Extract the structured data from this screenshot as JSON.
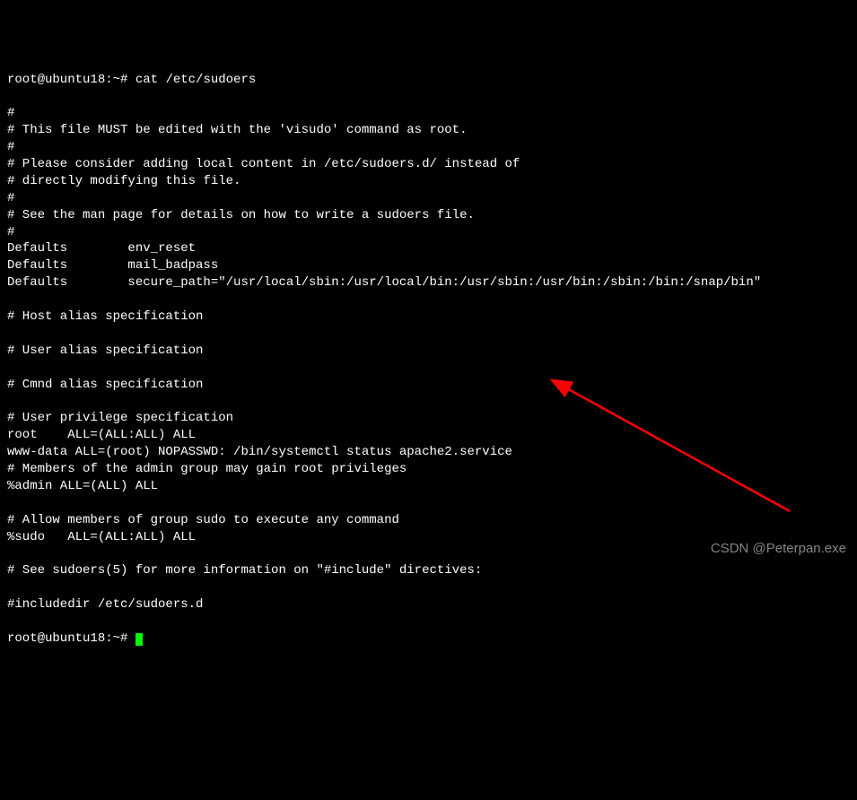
{
  "prompt1": {
    "user": "root@ubuntu18",
    "sep": ":",
    "path": "~",
    "symbol": "#",
    "command": "cat /etc/sudoers"
  },
  "lines": [
    "#",
    "# This file MUST be edited with the 'visudo' command as root.",
    "#",
    "# Please consider adding local content in /etc/sudoers.d/ instead of",
    "# directly modifying this file.",
    "#",
    "# See the man page for details on how to write a sudoers file.",
    "#",
    "Defaults        env_reset",
    "Defaults        mail_badpass",
    "Defaults        secure_path=\"/usr/local/sbin:/usr/local/bin:/usr/sbin:/usr/bin:/sbin:/bin:/snap/bin\"",
    "",
    "# Host alias specification",
    "",
    "# User alias specification",
    "",
    "# Cmnd alias specification",
    "",
    "# User privilege specification",
    "root    ALL=(ALL:ALL) ALL",
    "www-data ALL=(root) NOPASSWD: /bin/systemctl status apache2.service",
    "# Members of the admin group may gain root privileges",
    "%admin ALL=(ALL) ALL",
    "",
    "# Allow members of group sudo to execute any command",
    "%sudo   ALL=(ALL:ALL) ALL",
    "",
    "# See sudoers(5) for more information on \"#include\" directives:",
    "",
    "#includedir /etc/sudoers.d"
  ],
  "prompt2": {
    "user": "root@ubuntu18",
    "sep": ":",
    "path": "~",
    "symbol": "#"
  },
  "watermark": "CSDN @Peterpan.exe",
  "arrow_color": "#ff0000"
}
